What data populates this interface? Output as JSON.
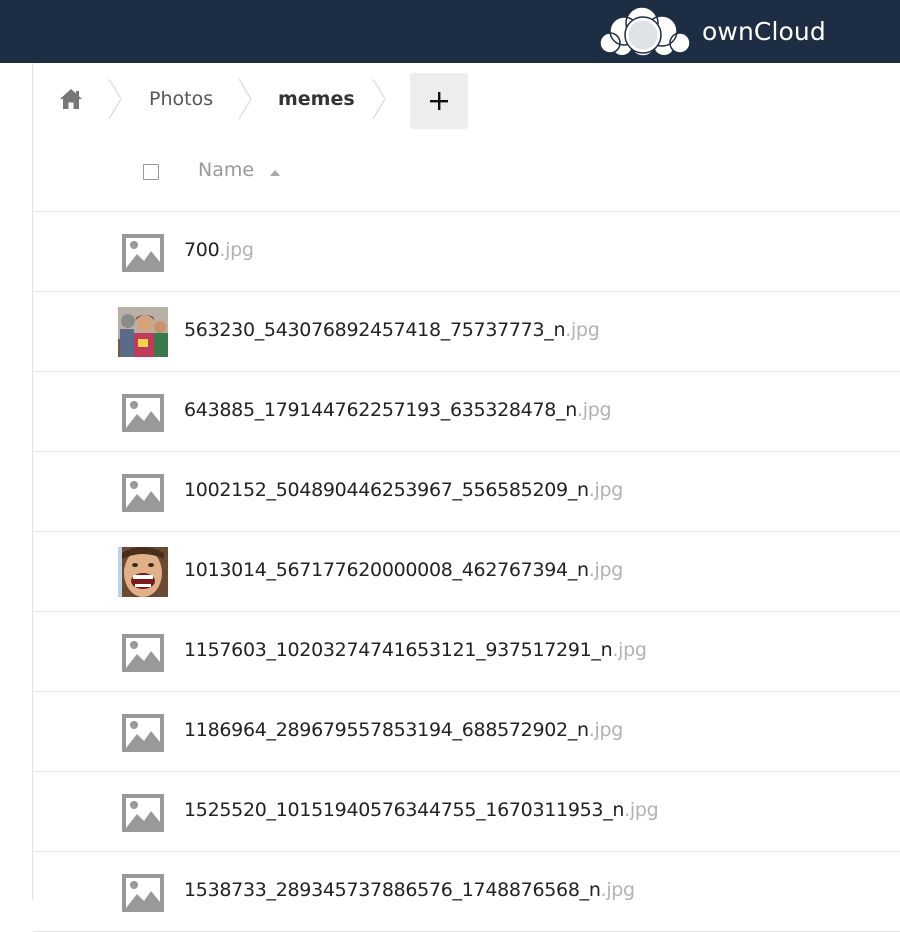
{
  "app": {
    "brand_name": "ownCloud",
    "header_color": "#1d2d44"
  },
  "breadcrumb": {
    "home_icon": "home-icon",
    "items": [
      "Photos",
      "memes"
    ]
  },
  "new_button": {
    "icon": "plus-icon"
  },
  "table": {
    "header_name": "Name",
    "sort_icon": "sort-ascending-icon",
    "rows": [
      {
        "name": "700",
        "ext": ".jpg",
        "thumb": "image-placeholder-icon"
      },
      {
        "name": "563230_543076892457418_75737773_n",
        "ext": ".jpg",
        "thumb": "photo-thumbnail-group"
      },
      {
        "name": "643885_179144762257193_635328478_n",
        "ext": ".jpg",
        "thumb": "image-placeholder-icon"
      },
      {
        "name": "1002152_504890446253967_556585209_n",
        "ext": ".jpg",
        "thumb": "image-placeholder-icon"
      },
      {
        "name": "1013014_567177620000008_462767394_n",
        "ext": ".jpg",
        "thumb": "photo-thumbnail-face"
      },
      {
        "name": "1157603_10203274741653121_937517291_n",
        "ext": ".jpg",
        "thumb": "image-placeholder-icon"
      },
      {
        "name": "1186964_289679557853194_688572902_n",
        "ext": ".jpg",
        "thumb": "image-placeholder-icon"
      },
      {
        "name": "1525520_10151940576344755_1670311953_n",
        "ext": ".jpg",
        "thumb": "image-placeholder-icon"
      },
      {
        "name": "1538733_289345737886576_1748876568_n",
        "ext": ".jpg",
        "thumb": "image-placeholder-icon"
      }
    ]
  }
}
